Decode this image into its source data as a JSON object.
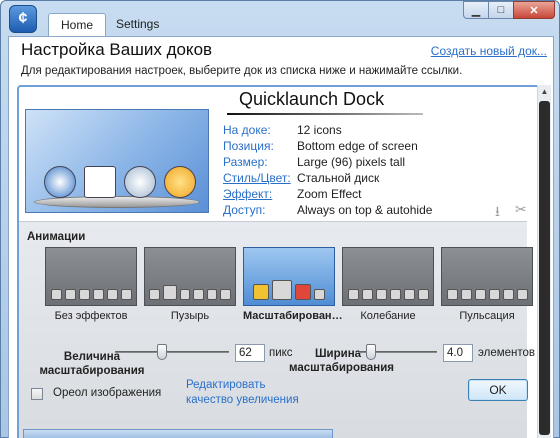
{
  "tabs": [
    {
      "label": "Home"
    },
    {
      "label": "Settings"
    }
  ],
  "header": {
    "title": "Настройка Ваших доков",
    "create_link": "Создать новый док...",
    "instructions": "Для редактирования настроек, выберите док из списка ниже и нажимайте ссылки."
  },
  "dock": {
    "title": "Quicklaunch Dock",
    "info": [
      {
        "label": "На доке:",
        "value": "12 icons"
      },
      {
        "label": "Позиция:",
        "value": "Bottom edge of screen"
      },
      {
        "label": "Размер:",
        "value": "Large (96) pixels tall"
      },
      {
        "label": "Стиль/Цвет:",
        "value": "Стальной диск"
      },
      {
        "label": "Эффект:",
        "value": "Zoom Effect"
      },
      {
        "label": "Доступ:",
        "value": "Always on top & autohide"
      }
    ]
  },
  "animations": {
    "header": "Анимации",
    "options": [
      {
        "label": "Без эффектов",
        "selected": false
      },
      {
        "label": "Пузырь",
        "selected": false
      },
      {
        "label": "Масштабирован…",
        "selected": true
      },
      {
        "label": "Колебание",
        "selected": false
      },
      {
        "label": "Пульсация",
        "selected": false
      }
    ]
  },
  "zoom": {
    "label": "Величина масштабирования",
    "value": "62",
    "unit": "пикс",
    "level": 0.4
  },
  "width": {
    "label": "Ширина масштабирования",
    "value": "4.0",
    "unit": "элементов",
    "level": 0.1
  },
  "footer": {
    "checkbox_label": "Ореол изображения",
    "quality_link": "Редактировать качество увеличения",
    "ok_label": "OK"
  },
  "colors": {
    "accent": "#6fa0d8",
    "link": "#2a6fc9"
  }
}
